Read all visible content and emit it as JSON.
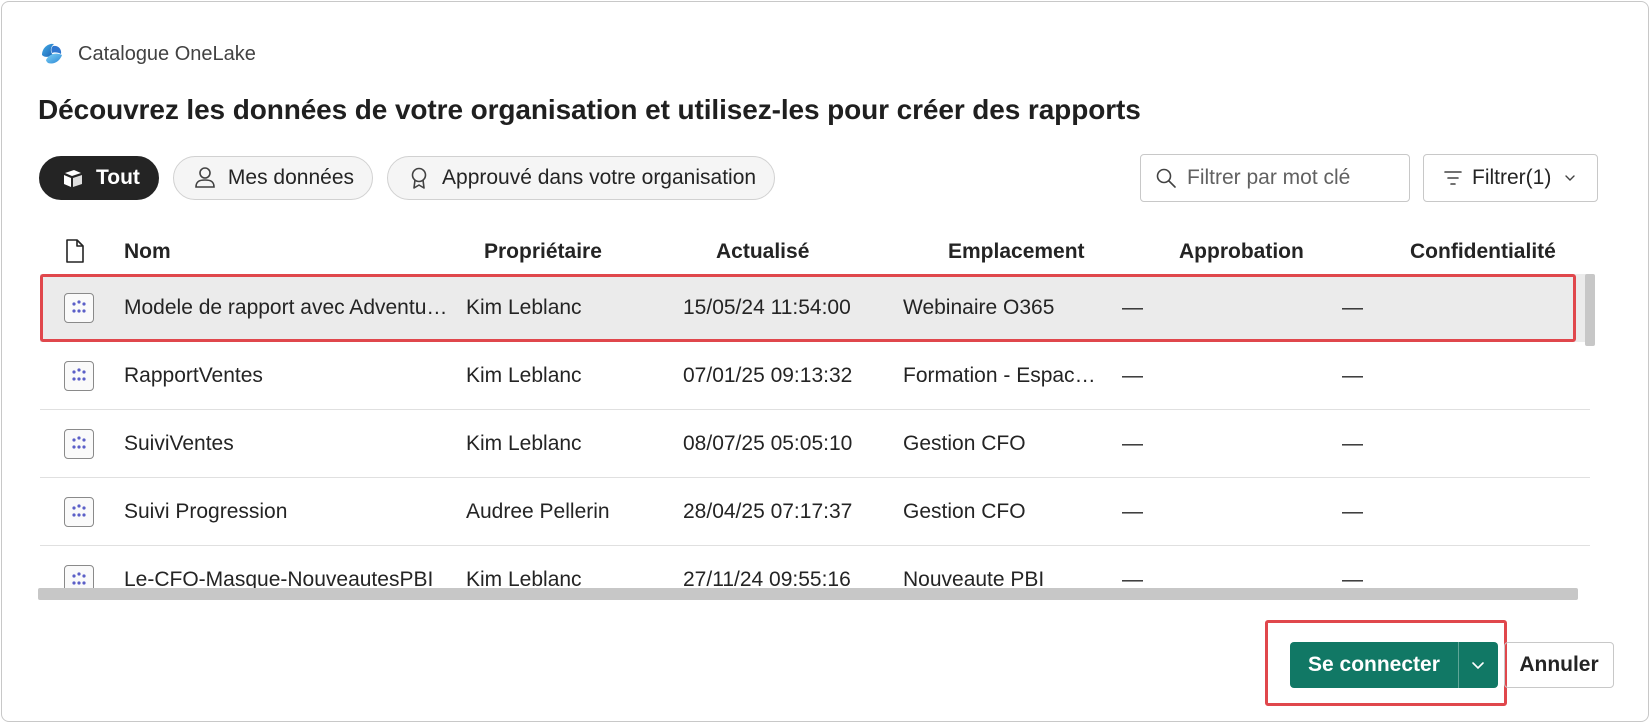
{
  "header": {
    "app_name": "Catalogue OneLake",
    "app_icon": "onelake-logo-icon"
  },
  "title": "Découvrez les données de votre organisation et utilisez-les pour créer des rapports",
  "chips": [
    {
      "label": "Tout",
      "icon": "all-items-icon",
      "active": true
    },
    {
      "label": "Mes données",
      "icon": "person-icon",
      "active": false
    },
    {
      "label": "Approuvé dans votre organisation",
      "icon": "ribbon-icon",
      "active": false
    }
  ],
  "search": {
    "placeholder": "Filtrer par mot clé",
    "value": ""
  },
  "filter": {
    "label": "Filtrer(1)"
  },
  "table": {
    "columns": [
      "Nom",
      "Propriétaire",
      "Actualisé",
      "Emplacement",
      "Approbation",
      "Confidentialité"
    ],
    "rows": [
      {
        "name": "Modele de rapport avec AdventureWorks",
        "owner": "Kim Leblanc",
        "refreshed": "15/05/24 11:54:00",
        "location": "Webinaire O365",
        "approval": "—",
        "sensitivity": "—",
        "selected": true
      },
      {
        "name": "RapportVentes",
        "owner": "Kim Leblanc",
        "refreshed": "07/01/25 09:13:32",
        "location": "Formation - Espace de travail",
        "approval": "—",
        "sensitivity": "—",
        "selected": false
      },
      {
        "name": "SuiviVentes",
        "owner": "Kim Leblanc",
        "refreshed": "08/07/25 05:05:10",
        "location": "Gestion CFO",
        "approval": "—",
        "sensitivity": "—",
        "selected": false
      },
      {
        "name": "Suivi Progression",
        "owner": "Audree Pellerin",
        "refreshed": "28/04/25 07:17:37",
        "location": "Gestion CFO",
        "approval": "—",
        "sensitivity": "—",
        "selected": false
      },
      {
        "name": "Le-CFO-Masque-NouveautesPBI",
        "owner": "Kim Leblanc",
        "refreshed": "27/11/24 09:55:16",
        "location": "Nouveaute PBI",
        "approval": "—",
        "sensitivity": "—",
        "selected": false
      }
    ]
  },
  "footer": {
    "connect_label": "Se connecter",
    "cancel_label": "Annuler"
  },
  "colors": {
    "accent": "#117865",
    "highlight": "#e0474c",
    "selected_row": "#ebebeb"
  }
}
